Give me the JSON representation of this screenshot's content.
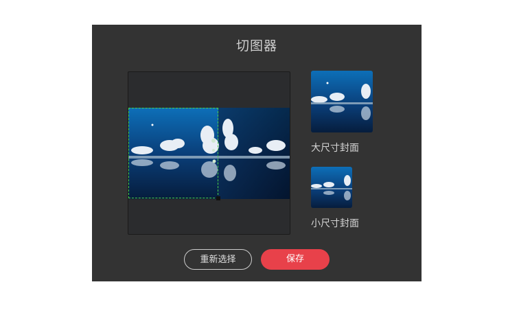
{
  "dialog": {
    "title": "切图器",
    "reselect_label": "重新选择",
    "save_label": "保存"
  },
  "previews": {
    "large_label": "大尺寸封面",
    "small_label": "小尺寸封面"
  },
  "colors": {
    "dialog_bg": "#333333",
    "crop_border": "#4bd34b",
    "save_button": "#e8414a"
  }
}
